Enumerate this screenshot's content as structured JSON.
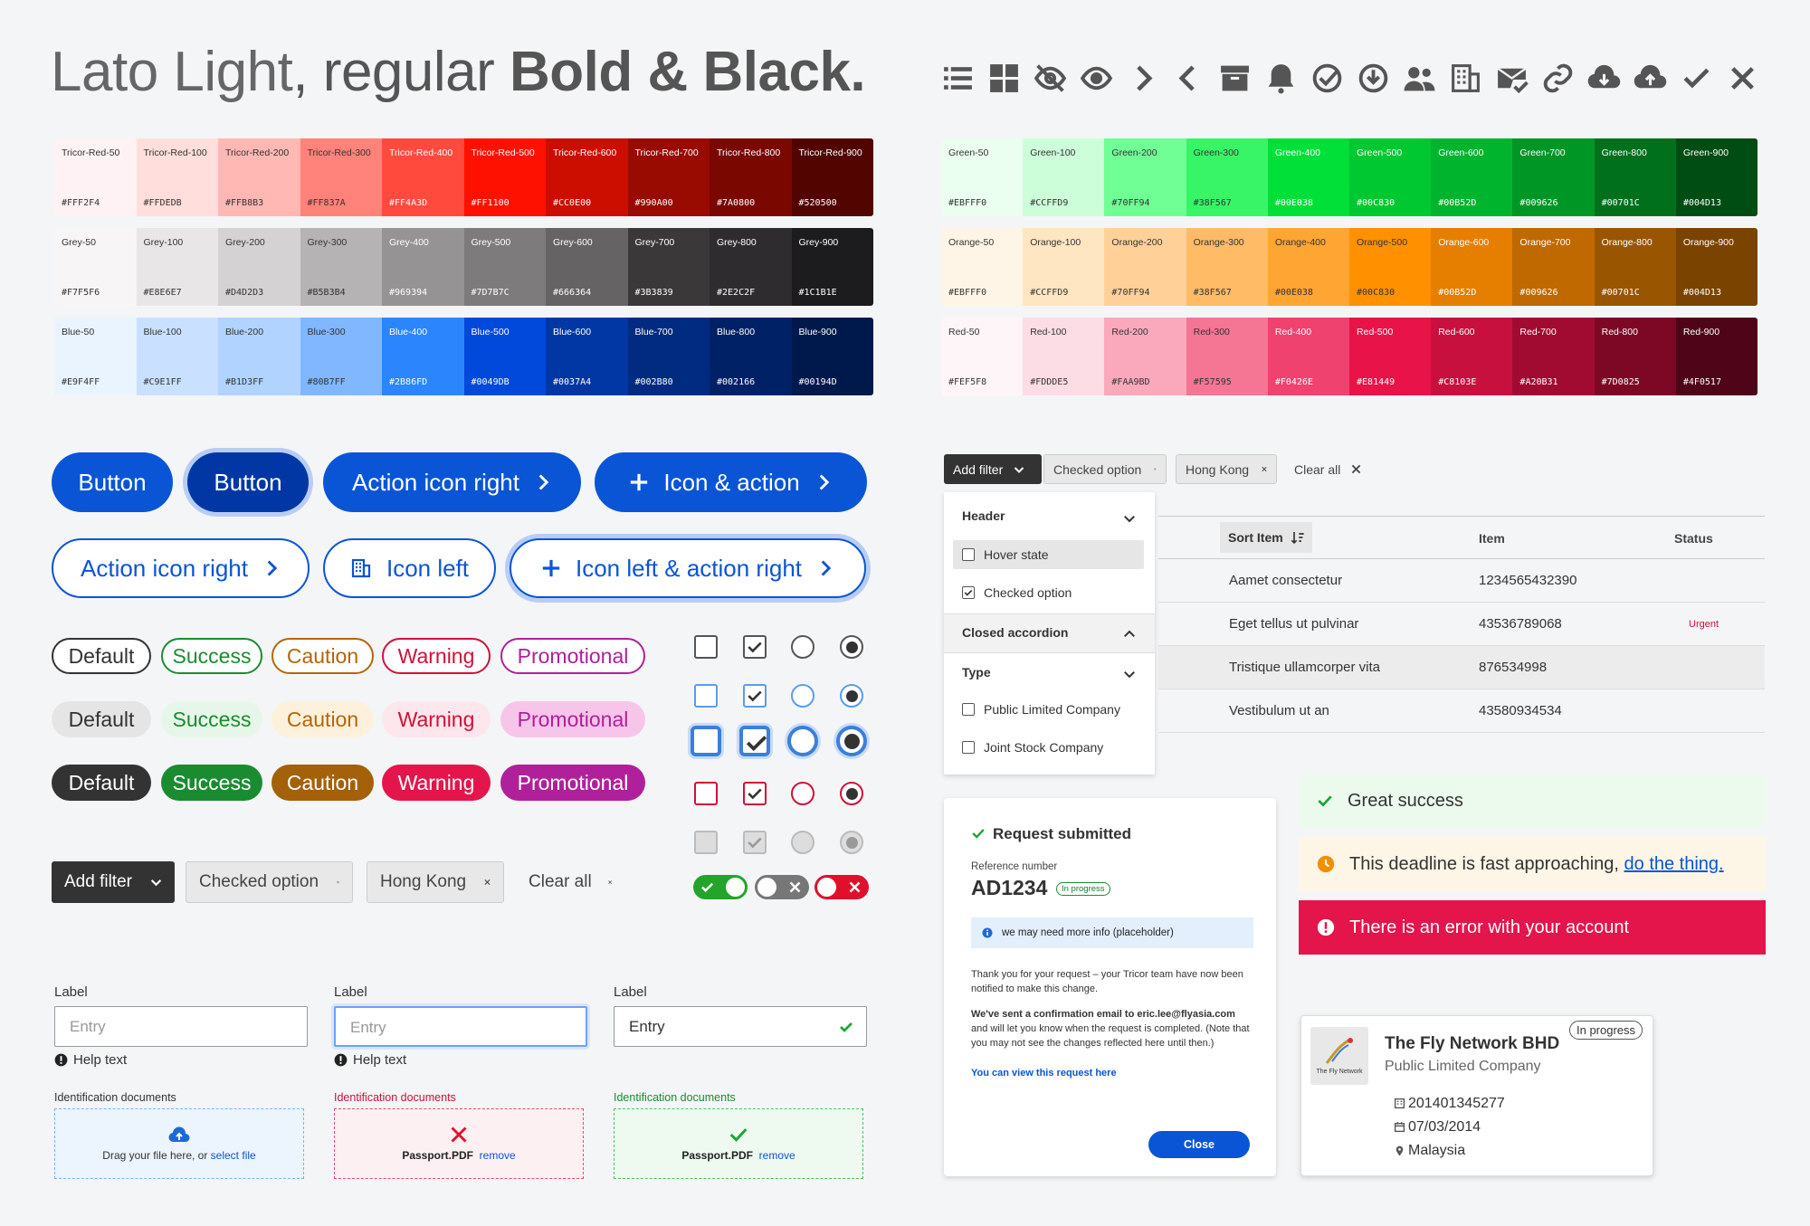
{
  "header": {
    "title_light": "Lato Light",
    "title_comma": ", regular ",
    "title_bold": "Bold & Black."
  },
  "icons": [
    "list-icon",
    "grid-icon",
    "eye-off-icon",
    "eye-icon",
    "chevron-right-icon",
    "chevron-left-icon",
    "archive-icon",
    "bell-icon",
    "check-circle-icon",
    "download-circle-icon",
    "users-icon",
    "building-icon",
    "mail-check-icon",
    "link-icon",
    "cloud-download-icon",
    "cloud-upload-icon",
    "check-icon",
    "close-icon"
  ],
  "palettes_left": [
    {
      "name": "tricor-red",
      "swatches": [
        {
          "n": "Tricor-Red-50",
          "h": "#FFF2F4"
        },
        {
          "n": "Tricor-Red-100",
          "h": "#FFDEDB"
        },
        {
          "n": "Tricor-Red-200",
          "h": "#FFB8B3"
        },
        {
          "n": "Tricor-Red-300",
          "h": "#FF837A"
        },
        {
          "n": "Tricor-Red-400",
          "h": "#FF4A3D"
        },
        {
          "n": "Tricor-Red-500",
          "h": "#FF1100"
        },
        {
          "n": "Tricor-Red-600",
          "h": "#CC0E00"
        },
        {
          "n": "Tricor-Red-700",
          "h": "#990A00"
        },
        {
          "n": "Tricor-Red-800",
          "h": "#7A0800"
        },
        {
          "n": "Tricor-Red-900",
          "h": "#520500"
        }
      ]
    },
    {
      "name": "grey",
      "swatches": [
        {
          "n": "Grey-50",
          "h": "#F7F5F6"
        },
        {
          "n": "Grey-100",
          "h": "#E8E6E7"
        },
        {
          "n": "Grey-200",
          "h": "#D4D2D3"
        },
        {
          "n": "Grey-300",
          "h": "#B5B3B4"
        },
        {
          "n": "Grey-400",
          "h": "#969394"
        },
        {
          "n": "Grey-500",
          "h": "#7D7B7C"
        },
        {
          "n": "Grey-600",
          "h": "#666364"
        },
        {
          "n": "Grey-700",
          "h": "#3B3839"
        },
        {
          "n": "Grey-800",
          "h": "#2E2C2F"
        },
        {
          "n": "Grey-900",
          "h": "#1C1B1E"
        }
      ]
    },
    {
      "name": "blue",
      "swatches": [
        {
          "n": "Blue-50",
          "h": "#E9F4FF"
        },
        {
          "n": "Blue-100",
          "h": "#C9E1FF"
        },
        {
          "n": "Blue-200",
          "h": "#B1D3FF"
        },
        {
          "n": "Blue-300",
          "h": "#80B7FF"
        },
        {
          "n": "Blue-400",
          "h": "#2B86FD"
        },
        {
          "n": "Blue-500",
          "h": "#0049DB"
        },
        {
          "n": "Blue-600",
          "h": "#0037A4"
        },
        {
          "n": "Blue-700",
          "h": "#002B80"
        },
        {
          "n": "Blue-800",
          "h": "#002166"
        },
        {
          "n": "Blue-900",
          "h": "#00194D"
        }
      ]
    }
  ],
  "palettes_right": [
    {
      "name": "green",
      "swatches": [
        {
          "n": "Green-50",
          "h": "#EBFFF0",
          "c": "#EBFFF0"
        },
        {
          "n": "Green-100",
          "h": "#CCFFD9",
          "c": "#CCFFD9"
        },
        {
          "n": "Green-200",
          "h": "#70FF94",
          "c": "#70FF94"
        },
        {
          "n": "Green-300",
          "h": "#38F567",
          "c": "#38F567"
        },
        {
          "n": "Green-400",
          "h": "#00E038",
          "c": "#00E038"
        },
        {
          "n": "Green-500",
          "h": "#00C830",
          "c": "#00C830"
        },
        {
          "n": "Green-600",
          "h": "#00B52D",
          "c": "#00B52D"
        },
        {
          "n": "Green-700",
          "h": "#009626",
          "c": "#009626"
        },
        {
          "n": "Green-800",
          "h": "#00701C",
          "c": "#00701C"
        },
        {
          "n": "Green-900",
          "h": "#004D13",
          "c": "#004D13"
        }
      ]
    },
    {
      "name": "orange",
      "swatches": [
        {
          "n": "Orange-50",
          "h": "#EBFFF0",
          "c": "#FFF5E6"
        },
        {
          "n": "Orange-100",
          "h": "#CCFFD9",
          "c": "#FFE6C2"
        },
        {
          "n": "Orange-200",
          "h": "#70FF94",
          "c": "#FFD199"
        },
        {
          "n": "Orange-300",
          "h": "#38F567",
          "c": "#FFBB66"
        },
        {
          "n": "Orange-400",
          "h": "#00E038",
          "c": "#FFA533"
        },
        {
          "n": "Orange-500",
          "h": "#00C830",
          "c": "#FF9100"
        },
        {
          "n": "Orange-600",
          "h": "#00B52D",
          "c": "#E67E00"
        },
        {
          "n": "Orange-700",
          "h": "#009626",
          "c": "#BF6900"
        },
        {
          "n": "Orange-800",
          "h": "#00701C",
          "c": "#995500"
        },
        {
          "n": "Orange-900",
          "h": "#004D13",
          "c": "#7A4300"
        }
      ]
    },
    {
      "name": "red",
      "swatches": [
        {
          "n": "Red-50",
          "h": "#FEF5F8",
          "c": "#FEF5F8"
        },
        {
          "n": "Red-100",
          "h": "#FDDDE5",
          "c": "#FDDDE5"
        },
        {
          "n": "Red-200",
          "h": "#FAA9BD",
          "c": "#FAA9BD"
        },
        {
          "n": "Red-300",
          "h": "#F57595",
          "c": "#F57595"
        },
        {
          "n": "Red-400",
          "h": "#F0426E",
          "c": "#F0426E"
        },
        {
          "n": "Red-500",
          "h": "#E81449",
          "c": "#E81449"
        },
        {
          "n": "Red-600",
          "h": "#C8103E",
          "c": "#C8103E"
        },
        {
          "n": "Red-700",
          "h": "#A20B31",
          "c": "#A20B31"
        },
        {
          "n": "Red-800",
          "h": "#7D0825",
          "c": "#7D0825"
        },
        {
          "n": "Red-900",
          "h": "#4F0517",
          "c": "#4F0517"
        }
      ]
    }
  ],
  "buttons": {
    "b1": "Button",
    "b2": "Button",
    "b3": "Action icon right",
    "b4": "Icon & action",
    "b5": "Action icon right",
    "b6": "Icon left",
    "b7": "Icon left & action right"
  },
  "pills": [
    "Default",
    "Success",
    "Caution",
    "Warning",
    "Promotional"
  ],
  "chips_left": {
    "add_filter": "Add filter",
    "checked": "Checked option",
    "hk": "Hong Kong",
    "clear": "Clear all"
  },
  "form": {
    "label": "Label",
    "placeholder": "Entry",
    "value": "Entry",
    "help": "Help text",
    "docs": "Identification documents",
    "drag": "Drag your file here, or ",
    "select": "select file",
    "file": "Passport.PDF",
    "remove": "remove"
  },
  "filter_panel": {
    "add_filter": "Add filter",
    "checked": "Checked option",
    "hk": "Hong Kong",
    "clear": "Clear all",
    "header": "Header",
    "hover": "Hover state",
    "checked_item": "Checked option",
    "closed": "Closed accordion",
    "type": "Type",
    "plc": "Public Limited Company",
    "jsc": "Joint Stock Company"
  },
  "table": {
    "sort": "Sort Item",
    "item": "Item",
    "status": "Status",
    "rows": [
      {
        "a": "Aamet consectetur",
        "b": "1234565432390",
        "s": ""
      },
      {
        "a": "Eget tellus ut pulvinar",
        "b": "43536789068",
        "s": "Urgent"
      },
      {
        "a": "Tristique ullamcorper vita",
        "b": "876534998",
        "s": ""
      },
      {
        "a": "Vestibulum ut an",
        "b": "43580934534",
        "s": ""
      }
    ]
  },
  "request": {
    "title": "Request submitted",
    "ref_label": "Reference number",
    "ref": "AD1234",
    "badge": "In progress",
    "info": "we may need more info (placeholder)",
    "p1": "Thank you  for your request – your Tricor team have now been notified to make this change.",
    "p2b": "We've sent a confirmation email to eric.lee@flyasia.com",
    "p2": " and will let you know when the request is completed. (Note that you may not see the changes reflected here until then.)",
    "link": "You can view this request here",
    "close": "Close"
  },
  "alerts": {
    "success": "Great success",
    "warn": "This deadline is fast approaching, ",
    "warn_link": "do the thing.",
    "error": "There is an error with your account"
  },
  "company": {
    "name": "The Fly Network BHD",
    "type": "Public Limited Company",
    "badge": "In progress",
    "reg": "201401345277",
    "date": "07/03/2014",
    "country": "Malaysia",
    "logo_text": "The Fly Network"
  }
}
